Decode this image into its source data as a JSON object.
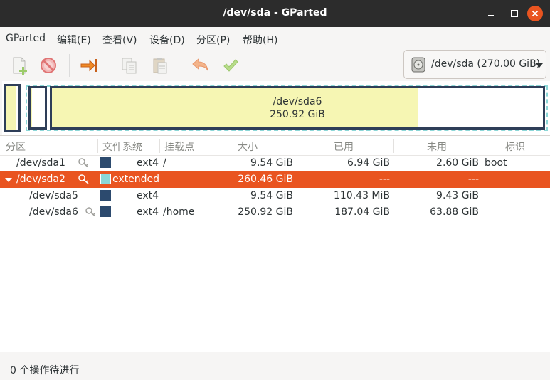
{
  "window": {
    "title": "/dev/sda - GParted"
  },
  "menubar": {
    "items": [
      {
        "label": "GParted"
      },
      {
        "label": "编辑(E)"
      },
      {
        "label": "查看(V)"
      },
      {
        "label": "设备(D)"
      },
      {
        "label": "分区(P)"
      },
      {
        "label": "帮助(H)"
      }
    ]
  },
  "toolbar": {
    "buttons": [
      {
        "icon": "new-partition-icon",
        "enabled": false
      },
      {
        "icon": "delete-icon",
        "enabled": false
      },
      {
        "icon": "resize-move-icon",
        "enabled": true
      },
      {
        "icon": "copy-icon",
        "enabled": false
      },
      {
        "icon": "paste-icon",
        "enabled": false
      },
      {
        "icon": "undo-icon",
        "enabled": false
      },
      {
        "icon": "apply-icon",
        "enabled": false
      }
    ],
    "device_selector": {
      "icon": "harddisk-icon",
      "label": "/dev/sda (270.00 GiB)"
    }
  },
  "partition_map": {
    "selected": {
      "name": "/dev/sda6",
      "size": "250.92 GiB"
    },
    "colors": {
      "border": "#2e3e58",
      "used": "#f6f6b3",
      "extended": "#8cd7d7"
    }
  },
  "table": {
    "columns": [
      "分区",
      "文件系统",
      "挂载点",
      "大小",
      "已用",
      "未用",
      "标识"
    ],
    "rows": [
      {
        "partition": "/dev/sda1",
        "key_icon": true,
        "fs_color": "#2c4a6e",
        "filesystem": "ext4",
        "mount": "/",
        "size": "9.54 GiB",
        "used": "6.94 GiB",
        "unused": "2.60 GiB",
        "flags": "boot"
      },
      {
        "partition": "/dev/sda2",
        "key_icon": true,
        "fs_color": "#8cd7d7",
        "filesystem": "extended",
        "mount": "",
        "size": "260.46 GiB",
        "used": "---",
        "unused": "---",
        "flags": "",
        "selected": true
      },
      {
        "partition": "/dev/sda5",
        "key_icon": false,
        "fs_color": "#2c4a6e",
        "filesystem": "ext4",
        "mount": "",
        "size": "9.54 GiB",
        "used": "110.43 MiB",
        "unused": "9.43 GiB",
        "flags": ""
      },
      {
        "partition": "/dev/sda6",
        "key_icon": true,
        "fs_color": "#2c4a6e",
        "filesystem": "ext4",
        "mount": "/home",
        "size": "250.92 GiB",
        "used": "187.04 GiB",
        "unused": "63.88 GiB",
        "flags": ""
      }
    ]
  },
  "statusbar": {
    "text": "0 个操作待进行"
  }
}
